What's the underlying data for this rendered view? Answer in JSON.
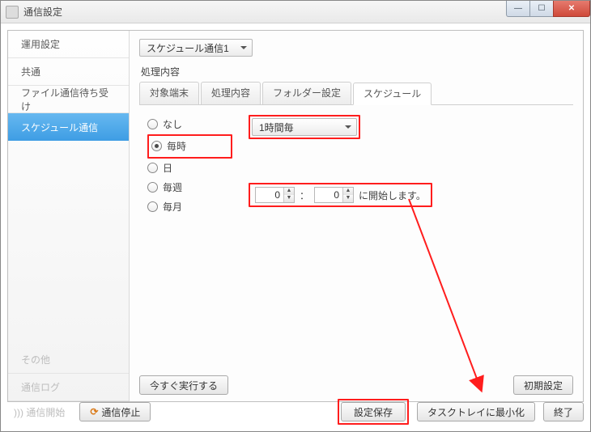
{
  "window": {
    "title": "通信設定"
  },
  "win_controls": {
    "min": "—",
    "max": "☐",
    "close": "✕"
  },
  "sidebar": {
    "items": [
      {
        "label": "運用設定"
      },
      {
        "label": "共通"
      },
      {
        "label": "ファイル通信待ち受け"
      },
      {
        "label": "スケジュール通信"
      }
    ],
    "items_bottom": [
      {
        "label": "その他"
      },
      {
        "label": "通信ログ"
      }
    ]
  },
  "profile_select": "スケジュール通信1",
  "section_title": "処理内容",
  "tabs": [
    {
      "label": "対象端末"
    },
    {
      "label": "処理内容"
    },
    {
      "label": "フォルダー設定"
    },
    {
      "label": "スケジュール"
    }
  ],
  "schedule": {
    "radios": {
      "none": "なし",
      "hourly": "毎時",
      "daily": "日",
      "weekly": "毎週",
      "monthly": "毎月"
    },
    "interval_label": "1時間毎",
    "hour": "0",
    "minute": "0",
    "colon": "：",
    "start_suffix": "に開始します。"
  },
  "buttons": {
    "run_now": "今すぐ実行する",
    "defaults": "初期設定",
    "start_comm": "通信開始",
    "stop_comm": "通信停止",
    "save": "設定保存",
    "minimize_tray": "タスクトレイに最小化",
    "exit": "終了"
  }
}
